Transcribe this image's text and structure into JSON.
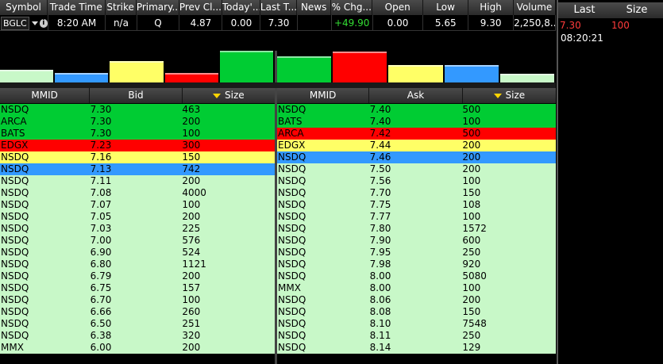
{
  "quote": {
    "headers": [
      "Symbol",
      "Trade Time",
      "Strike",
      "Primary...",
      "Prev Cl...",
      "Today'...",
      "Last T...",
      "News",
      "% Chg...",
      "Open",
      "Low",
      "High",
      "Volume"
    ],
    "symbol": "BGLC",
    "trade_time": "8:20 AM",
    "strike": "n/a",
    "primary": "Q",
    "prev_close": "4.87",
    "today": "0.00",
    "last": "7.30",
    "news": "",
    "pct_change": "+49.90",
    "open": "0.00",
    "low": "5.65",
    "high": "9.30",
    "volume": "2,250,8..."
  },
  "time_sales": {
    "headers": [
      "Last",
      "Size"
    ],
    "last": "7.30",
    "size": "100",
    "time": "08:20:21",
    "last_color": "#ff3b3b"
  },
  "colors": {
    "green": "#00cc33",
    "red": "#ff0000",
    "yellow": "#ffff66",
    "blue": "#3399ff",
    "light": "#c8f8c8"
  },
  "depth_bars": {
    "bid": [
      {
        "level": 0.35,
        "color": "light"
      },
      {
        "level": 0.25,
        "color": "blue"
      },
      {
        "level": 0.62,
        "color": "yellow"
      },
      {
        "level": 0.25,
        "color": "red"
      },
      {
        "level": 0.95,
        "color": "green"
      }
    ],
    "ask": [
      {
        "level": 0.78,
        "color": "green"
      },
      {
        "level": 0.92,
        "color": "red"
      },
      {
        "level": 0.5,
        "color": "yellow"
      },
      {
        "level": 0.5,
        "color": "blue"
      },
      {
        "level": 0.22,
        "color": "light"
      }
    ]
  },
  "bid_book": {
    "headers": [
      "MMID",
      "Bid",
      "Size"
    ],
    "rows": [
      {
        "mmid": "NSDQ",
        "price": "7.30",
        "size": "463",
        "color": "green"
      },
      {
        "mmid": "ARCA",
        "price": "7.30",
        "size": "200",
        "color": "green"
      },
      {
        "mmid": "BATS",
        "price": "7.30",
        "size": "100",
        "color": "green"
      },
      {
        "mmid": "EDGX",
        "price": "7.23",
        "size": "300",
        "color": "red"
      },
      {
        "mmid": "NSDQ",
        "price": "7.16",
        "size": "150",
        "color": "yellow"
      },
      {
        "mmid": "NSDQ",
        "price": "7.13",
        "size": "742",
        "color": "blue"
      },
      {
        "mmid": "NSDQ",
        "price": "7.11",
        "size": "200",
        "color": "light"
      },
      {
        "mmid": "NSDQ",
        "price": "7.08",
        "size": "4000",
        "color": "light"
      },
      {
        "mmid": "NSDQ",
        "price": "7.07",
        "size": "100",
        "color": "light"
      },
      {
        "mmid": "NSDQ",
        "price": "7.05",
        "size": "200",
        "color": "light"
      },
      {
        "mmid": "NSDQ",
        "price": "7.03",
        "size": "225",
        "color": "light"
      },
      {
        "mmid": "NSDQ",
        "price": "7.00",
        "size": "576",
        "color": "light"
      },
      {
        "mmid": "NSDQ",
        "price": "6.90",
        "size": "524",
        "color": "light"
      },
      {
        "mmid": "NSDQ",
        "price": "6.80",
        "size": "1121",
        "color": "light"
      },
      {
        "mmid": "NSDQ",
        "price": "6.79",
        "size": "200",
        "color": "light"
      },
      {
        "mmid": "NSDQ",
        "price": "6.75",
        "size": "157",
        "color": "light"
      },
      {
        "mmid": "NSDQ",
        "price": "6.70",
        "size": "100",
        "color": "light"
      },
      {
        "mmid": "NSDQ",
        "price": "6.66",
        "size": "260",
        "color": "light"
      },
      {
        "mmid": "NSDQ",
        "price": "6.50",
        "size": "251",
        "color": "light"
      },
      {
        "mmid": "NSDQ",
        "price": "6.38",
        "size": "320",
        "color": "light"
      },
      {
        "mmid": "MMX",
        "price": "6.00",
        "size": "200",
        "color": "light"
      }
    ]
  },
  "ask_book": {
    "headers": [
      "MMID",
      "Ask",
      "Size"
    ],
    "rows": [
      {
        "mmid": "NSDQ",
        "price": "7.40",
        "size": "500",
        "color": "green"
      },
      {
        "mmid": "BATS",
        "price": "7.40",
        "size": "100",
        "color": "green"
      },
      {
        "mmid": "ARCA",
        "price": "7.42",
        "size": "500",
        "color": "red"
      },
      {
        "mmid": "EDGX",
        "price": "7.44",
        "size": "200",
        "color": "yellow"
      },
      {
        "mmid": "NSDQ",
        "price": "7.46",
        "size": "200",
        "color": "blue"
      },
      {
        "mmid": "NSDQ",
        "price": "7.50",
        "size": "200",
        "color": "light"
      },
      {
        "mmid": "NSDQ",
        "price": "7.56",
        "size": "100",
        "color": "light"
      },
      {
        "mmid": "NSDQ",
        "price": "7.70",
        "size": "150",
        "color": "light"
      },
      {
        "mmid": "NSDQ",
        "price": "7.75",
        "size": "108",
        "color": "light"
      },
      {
        "mmid": "NSDQ",
        "price": "7.77",
        "size": "100",
        "color": "light"
      },
      {
        "mmid": "NSDQ",
        "price": "7.80",
        "size": "1572",
        "color": "light"
      },
      {
        "mmid": "NSDQ",
        "price": "7.90",
        "size": "600",
        "color": "light"
      },
      {
        "mmid": "NSDQ",
        "price": "7.95",
        "size": "250",
        "color": "light"
      },
      {
        "mmid": "NSDQ",
        "price": "7.98",
        "size": "920",
        "color": "light"
      },
      {
        "mmid": "NSDQ",
        "price": "8.00",
        "size": "5080",
        "color": "light"
      },
      {
        "mmid": "MMX",
        "price": "8.00",
        "size": "100",
        "color": "light"
      },
      {
        "mmid": "NSDQ",
        "price": "8.06",
        "size": "200",
        "color": "light"
      },
      {
        "mmid": "NSDQ",
        "price": "8.08",
        "size": "150",
        "color": "light"
      },
      {
        "mmid": "NSDQ",
        "price": "8.10",
        "size": "7548",
        "color": "light"
      },
      {
        "mmid": "NSDQ",
        "price": "8.11",
        "size": "250",
        "color": "light"
      },
      {
        "mmid": "NSDQ",
        "price": "8.14",
        "size": "129",
        "color": "light"
      }
    ]
  }
}
